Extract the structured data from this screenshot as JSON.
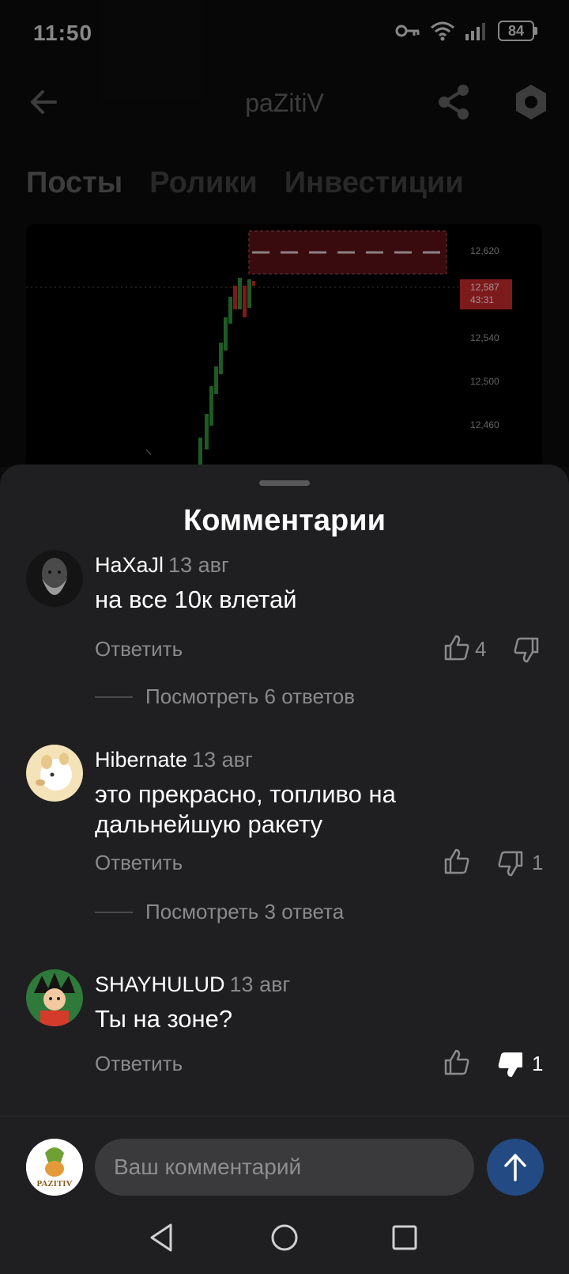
{
  "status_bar": {
    "time": "11:50",
    "battery": "84",
    "icons": [
      "key-icon",
      "wifi-icon",
      "signal-icon",
      "battery-icon"
    ]
  },
  "header": {
    "title": "paZitiV",
    "back_icon": "arrow-left-icon",
    "share_icon": "share-icon",
    "settings_icon": "hexagon-settings-icon"
  },
  "tabs": [
    {
      "label": "Посты",
      "active": true
    },
    {
      "label": "Ролики",
      "active": false
    },
    {
      "label": "Инвестиции",
      "active": false
    }
  ],
  "chart_preview": {
    "price_labels": [
      "12,620",
      "12,540",
      "12,500",
      "12,460"
    ],
    "current_price": "12,587",
    "countdown": "43:31",
    "colors": {
      "up": "#2e8b3a",
      "down": "#c0282c",
      "zone": "#5a1216"
    }
  },
  "comments_sheet": {
    "title": "Комментарии",
    "comments": [
      {
        "author": "HaXaJl",
        "date": "13 авг",
        "text": "на все 10к влетай",
        "reply_label": "Ответить",
        "likes": "4",
        "dislikes": "",
        "view_replies": "Посмотреть 6 ответов"
      },
      {
        "author": "Hibernate",
        "date": "13 авг",
        "text": "это прекрасно, топливо на дальнейшую ракету",
        "reply_label": "Ответить",
        "likes": "",
        "dislikes": "1",
        "view_replies": "Посмотреть 3 ответа"
      },
      {
        "author": "SHAYHULUD",
        "date": "13 авг",
        "text": "Ты на зоне?",
        "reply_label": "Ответить",
        "likes": "",
        "dislikes": "1",
        "dislike_active": true
      }
    ]
  },
  "input_bar": {
    "placeholder": "Ваш комментарий",
    "avatar_text": "PAZITIV",
    "send_icon": "arrow-up-icon",
    "send_color": "#234a83"
  },
  "nav_bar": {
    "icons": [
      "back-triangle-icon",
      "home-circle-icon",
      "recents-square-icon"
    ]
  }
}
